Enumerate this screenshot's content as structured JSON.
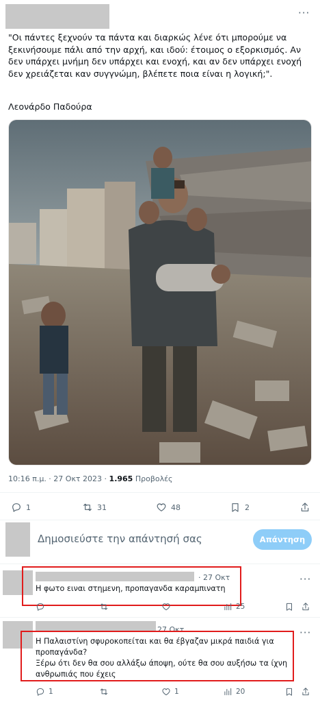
{
  "tweet": {
    "text": "\"Οι πάντες ξεχνούν τα πάντα και διαρκώς λένε ότι μπορούμε να ξεκινήσουμε πάλι από την αρχή, και ιδού: έτοιμος ο εξορκισμός. Αν δεν υπάρχει μνήμη δεν υπάρχει και ενοχή, και αν δεν υπάρχει ενοχή δεν χρειάζεται καν συγγνώμη, βλέπετε ποια είναι η λογική;\".",
    "signature": "Λεονάρδο Παδούρα",
    "time": "10:16 π.μ. · 27 Οκτ 2023 · ",
    "views_count": "1.965",
    "views_label": " Προβολές",
    "actions": {
      "replies": "1",
      "retweets": "31",
      "likes": "48",
      "bookmarks": "2"
    }
  },
  "reply_box": {
    "placeholder": "Δημοσιεύστε την απάντησή σας",
    "button": "Απάντηση"
  },
  "comments": [
    {
      "date": "· 27 Οκτ",
      "text": "Η φωτο ειναι στημενη, προπαγανδα καραμπινατη",
      "actions": {
        "replies": "",
        "retweets": "",
        "likes": "",
        "views": "25"
      }
    },
    {
      "date": "27 Οκτ",
      "text_lines": [
        "Η Παλαιστίνη σφυροκοπείται και θα έβγαζαν μικρά παιδιά για",
        "προπαγάνδα?",
        "Ξέρω ότι δεν θα σου αλλάξω άποψη, ούτε θα σου αυξήσω τα ίχνη",
        "ανθρωπιάς που έχεις"
      ],
      "actions": {
        "replies": "1",
        "retweets": "",
        "likes": "1",
        "views": "20"
      }
    }
  ],
  "colors": {
    "accent_disabled": "#8ecdf8",
    "highlight_box": "#e11b1b",
    "secondary_text": "#536471"
  },
  "icons": [
    "more-icon",
    "reply-icon",
    "retweet-icon",
    "like-icon",
    "bookmark-icon",
    "share-icon",
    "views-icon"
  ]
}
